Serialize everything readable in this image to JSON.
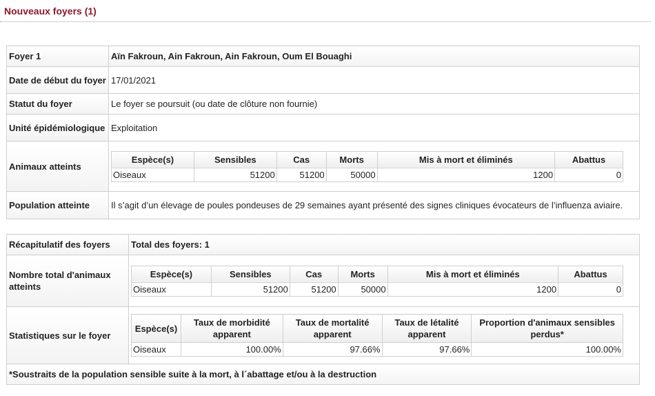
{
  "section": {
    "title": "Nouveaux foyers (1)"
  },
  "outbreak": {
    "foyer_label": "Foyer 1",
    "foyer_value": "Aïn Fakroun, Ain Fakroun, Ain Fakroun, Oum El Bouaghi",
    "start_label": "Date de début du foyer",
    "start_value": "17/01/2021",
    "status_label": "Statut du foyer",
    "status_value": "Le foyer se poursuit (ou date de clôture non fournie)",
    "unit_label": "Unité épidémiologique",
    "unit_value": "Exploitation",
    "animals_label": "Animaux atteints",
    "animals_table": {
      "headers": [
        "Espèce(s)",
        "Sensibles",
        "Cas",
        "Morts",
        "Mis à mort et éliminés",
        "Abattus"
      ],
      "rows": [
        [
          "Oiseaux",
          "51200",
          "51200",
          "50000",
          "1200",
          "0"
        ]
      ]
    },
    "population_label": "Population atteinte",
    "population_value": "Il s’agit d’un élevage de poules pondeuses de 29 semaines ayant présenté des signes cliniques évocateurs de l’influenza aviaire."
  },
  "summary": {
    "recap_label": "Récapitulatif des foyers",
    "recap_value": "Total des foyers: 1",
    "total_label": "Nombre total d'animaux atteints",
    "total_table": {
      "headers": [
        "Espèce(s)",
        "Sensibles",
        "Cas",
        "Morts",
        "Mis à mort et éliminés",
        "Abattus"
      ],
      "rows": [
        [
          "Oiseaux",
          "51200",
          "51200",
          "50000",
          "1200",
          "0"
        ]
      ]
    },
    "stats_label": "Statistiques sur le foyer",
    "stats_table": {
      "headers": [
        "Espèce(s)",
        "Taux de morbidité apparent",
        "Taux de mortalité apparent",
        "Taux de létalité apparent",
        "Proportion d'animaux sensibles perdus*"
      ],
      "rows": [
        [
          "Oiseaux",
          "100.00%",
          "97.66%",
          "97.66%",
          "100.00%"
        ]
      ]
    },
    "footnote": "*Soustraits de la population sensible suite à la mort, à l´abattage et/ou à la destruction"
  }
}
